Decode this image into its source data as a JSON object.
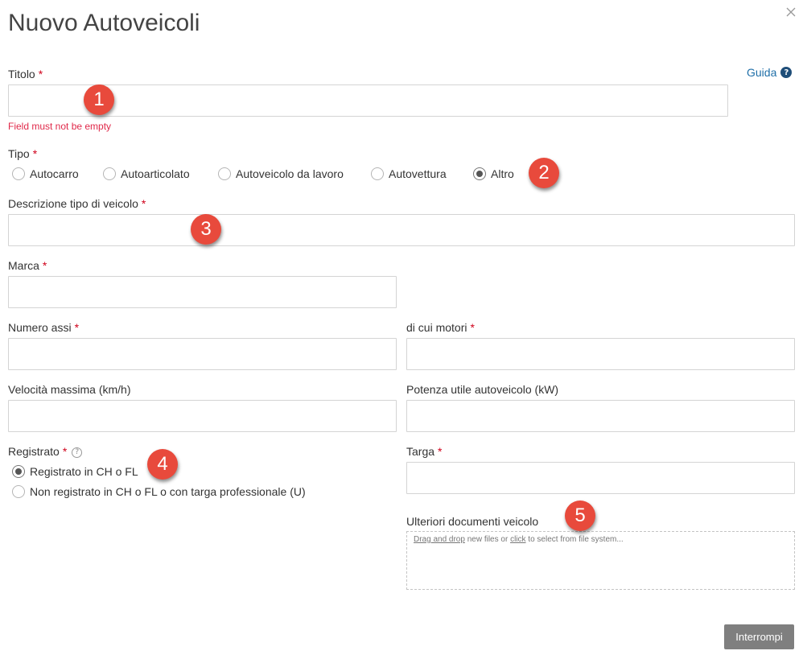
{
  "dialog": {
    "title": "Nuovo Autoveicoli",
    "help_label": "Guida",
    "help_icon": "question-circle-icon",
    "close_icon": "close-icon"
  },
  "required_marker": "*",
  "form": {
    "titolo": {
      "label": "Titolo",
      "value": "",
      "error": "Field must not be empty"
    },
    "tipo": {
      "label": "Tipo",
      "options": [
        "Autocarro",
        "Autoarticolato",
        "Autoveicolo da lavoro",
        "Autovettura",
        "Altro"
      ],
      "selected": "Altro"
    },
    "descrizione_tipo": {
      "label": "Descrizione tipo di veicolo",
      "value": ""
    },
    "marca": {
      "label": "Marca",
      "value": ""
    },
    "numero_assi": {
      "label": "Numero assi",
      "value": ""
    },
    "di_cui_motori": {
      "label": "di cui motori",
      "value": ""
    },
    "velocita_massima": {
      "label": "Velocità massima (km/h)",
      "value": ""
    },
    "potenza_utile": {
      "label": "Potenza utile autoveicolo (kW)",
      "value": ""
    },
    "registrato": {
      "label": "Registrato",
      "info_icon": "question-circle-icon",
      "options": [
        "Registrato in CH o FL",
        "Non registrato in CH o FL o con targa professionale (U)"
      ],
      "selected": "Registrato in CH o FL"
    },
    "targa": {
      "label": "Targa",
      "value": ""
    },
    "ulteriori_documenti": {
      "label": "Ulteriori documenti veicolo",
      "drag_link": "Drag and drop",
      "text_1": " new files or ",
      "click_link": "click",
      "text_2": " to select from file system..."
    }
  },
  "footer": {
    "cancel_label": "Interrompi"
  },
  "annotations": [
    "1",
    "2",
    "3",
    "4",
    "5"
  ],
  "colors": {
    "required": "#d0021b",
    "error": "#e0294a",
    "help_link": "#1f6fa8",
    "badge": "#e84a3c",
    "button": "#7f7f7f"
  }
}
